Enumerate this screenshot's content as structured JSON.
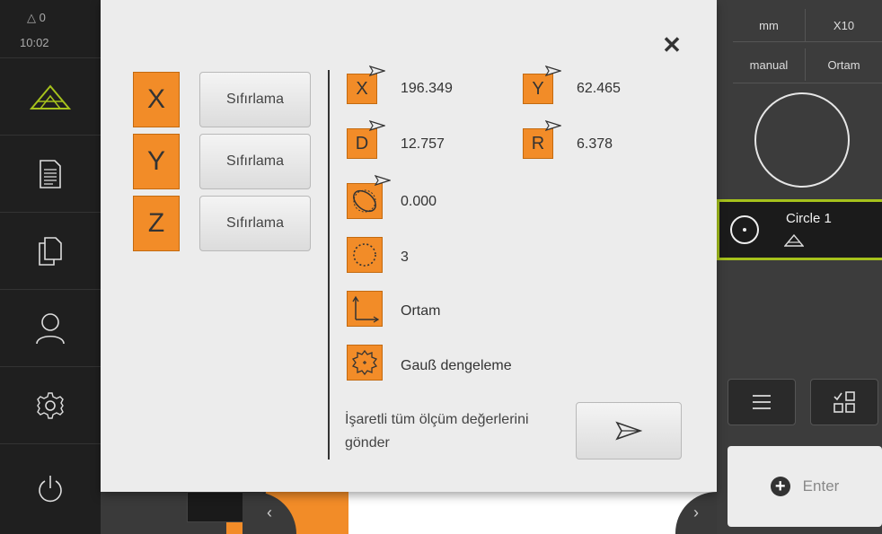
{
  "status": {
    "warnings": "0",
    "time": "10:02"
  },
  "sidebar": {
    "items": [
      {
        "icon": "measure-triangle-icon",
        "active": true
      },
      {
        "icon": "document-list-icon"
      },
      {
        "icon": "files-icon"
      },
      {
        "icon": "user-icon"
      },
      {
        "icon": "gear-icon"
      },
      {
        "icon": "power-icon"
      }
    ]
  },
  "right_panel": {
    "unit": "mm",
    "zoom": "X10",
    "mode": "manual",
    "reference": "Ortam",
    "feature": {
      "name": "Circle 1",
      "type_icon": "circle-icon"
    },
    "menu_icon": "menu-icon",
    "layout_icon": "layout-grid-icon",
    "enter_label": "Enter"
  },
  "dialog": {
    "close_glyph": "✕",
    "axes": [
      {
        "axis": "X",
        "reset_label": "Sıfırlama"
      },
      {
        "axis": "Y",
        "reset_label": "Sıfırlama"
      },
      {
        "axis": "Z",
        "reset_label": "Sıfırlama"
      }
    ],
    "values": {
      "x": {
        "label": "X",
        "value": "196.349"
      },
      "y": {
        "label": "Y",
        "value": "62.465"
      },
      "d": {
        "label": "D",
        "value": "12.757"
      },
      "r": {
        "label": "R",
        "value": "6.378"
      },
      "form_error": {
        "icon": "form-error-icon",
        "value": "0.000"
      },
      "point_count": {
        "icon": "point-count-icon",
        "value": "3"
      },
      "coord_system": {
        "icon": "coordinate-system-icon",
        "value": "Ortam"
      },
      "fit_method": {
        "icon": "gauss-fit-icon",
        "value": "Gauß dengeleme"
      }
    },
    "send_text": "İşaretli tüm ölçüm değerlerini gönder",
    "send_icon": "send-icon"
  },
  "colors": {
    "accent": "#f28c28",
    "highlight": "#a6c21c",
    "dialog_bg": "#ececec"
  }
}
